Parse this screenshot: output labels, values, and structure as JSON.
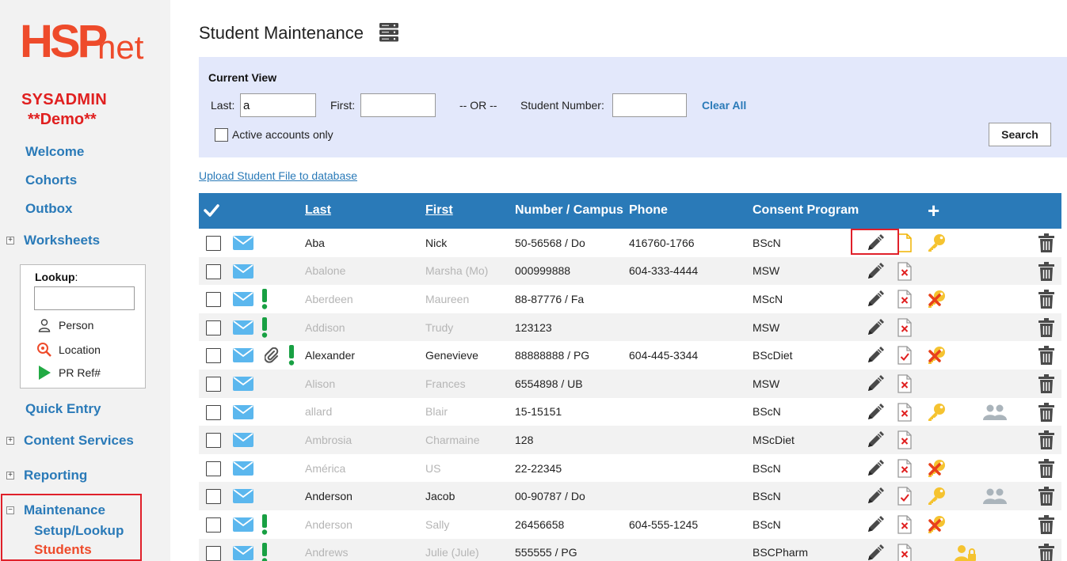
{
  "brand": {
    "logo_text_hsp": "HSP",
    "logo_text_net": "net"
  },
  "sidebar": {
    "role": "SYSADMIN",
    "env": "**Demo**",
    "links": {
      "welcome": "Welcome",
      "cohorts": "Cohorts",
      "outbox": "Outbox"
    },
    "groups": {
      "worksheets": "Worksheets",
      "content_services": "Content Services",
      "reporting": "Reporting",
      "maintenance": "Maintenance"
    },
    "lookup": {
      "label": "Lookup",
      "colon": ":",
      "value": "",
      "options": {
        "person": "Person",
        "location": "Location",
        "pr_ref": "PR Ref#"
      }
    },
    "quick_entry": "Quick Entry",
    "maintenance_items": {
      "setup": "Setup/Lookup",
      "students": "Students"
    },
    "colors": {
      "accent": "#2a7ab8",
      "alert": "#e02020"
    }
  },
  "main": {
    "title": "Student Maintenance",
    "current_view": {
      "label": "Current View",
      "last_label": "Last:",
      "last_value": "a",
      "first_label": "First:",
      "first_value": "",
      "or_text": "-- OR --",
      "student_number_label": "Student Number:",
      "student_number_value": "",
      "clear_all": "Clear All",
      "active_only_label": "Active accounts only",
      "active_only_checked": false,
      "search_label": "Search"
    },
    "upload_link": "Upload Student File to database",
    "table": {
      "columns": {
        "last": "Last",
        "first": "First",
        "number_campus": "Number / Campus",
        "phone": "Phone",
        "consent_program": "Consent Program",
        "add": "+"
      },
      "rows": [
        {
          "last": "Aba",
          "first": "Nick",
          "number": "50-56568 / Do",
          "phone": "416760-1766",
          "program": "BScN",
          "active": true,
          "doc": "blank",
          "key": "gold",
          "alert": false,
          "clip": false,
          "group": false
        },
        {
          "last": "Abalone",
          "first": "Marsha (Mo)",
          "number": "000999888",
          "phone": "604-333-4444",
          "program": "MSW",
          "active": false,
          "doc": "x",
          "key": "none",
          "alert": false,
          "clip": false,
          "group": false
        },
        {
          "last": "Aberdeen",
          "first": "Maureen",
          "number": "88-87776 / Fa",
          "phone": "",
          "program": "MScN",
          "active": false,
          "doc": "x",
          "key": "x",
          "alert": true,
          "clip": false,
          "group": false
        },
        {
          "last": "Addison",
          "first": "Trudy",
          "number": "123123",
          "phone": "",
          "program": "MSW",
          "active": false,
          "doc": "x",
          "key": "none",
          "alert": true,
          "clip": false,
          "group": false
        },
        {
          "last": "Alexander",
          "first": "Genevieve",
          "number": "88888888 / PG",
          "phone": "604-445-3344",
          "program": "BScDiet",
          "active": true,
          "doc": "check",
          "key": "x",
          "alert": true,
          "clip": true,
          "group": false
        },
        {
          "last": "Alison",
          "first": "Frances",
          "number": "6554898 / UB",
          "phone": "",
          "program": "MSW",
          "active": false,
          "doc": "x",
          "key": "none",
          "alert": false,
          "clip": false,
          "group": false
        },
        {
          "last": "allard",
          "first": "Blair",
          "number": "15-15151",
          "phone": "",
          "program": "BScN",
          "active": false,
          "doc": "x",
          "key": "gold",
          "alert": false,
          "clip": false,
          "group": true
        },
        {
          "last": "Ambrosia",
          "first": "Charmaine",
          "number": "128",
          "phone": "",
          "program": "MScDiet",
          "active": false,
          "doc": "x",
          "key": "none",
          "alert": false,
          "clip": false,
          "group": false
        },
        {
          "last": "América",
          "first": "US",
          "number": "22-22345",
          "phone": "",
          "program": "BScN",
          "active": false,
          "doc": "x",
          "key": "x",
          "alert": false,
          "clip": false,
          "group": false
        },
        {
          "last": "Anderson",
          "first": "Jacob",
          "number": "00-90787 / Do",
          "phone": "",
          "program": "BScN",
          "active": true,
          "doc": "check",
          "key": "gold",
          "alert": false,
          "clip": false,
          "group": true
        },
        {
          "last": "Anderson",
          "first": "Sally",
          "number": "26456658",
          "phone": "604-555-1245",
          "program": "BScN",
          "active": false,
          "doc": "x",
          "key": "x",
          "alert": true,
          "clip": false,
          "group": false
        },
        {
          "last": "Andrews",
          "first": "Julie (Jule)",
          "number": "555555 / PG",
          "phone": "",
          "program": "BSCPharm",
          "active": false,
          "doc": "x",
          "key": "user",
          "alert": true,
          "clip": false,
          "group": false
        }
      ]
    }
  }
}
